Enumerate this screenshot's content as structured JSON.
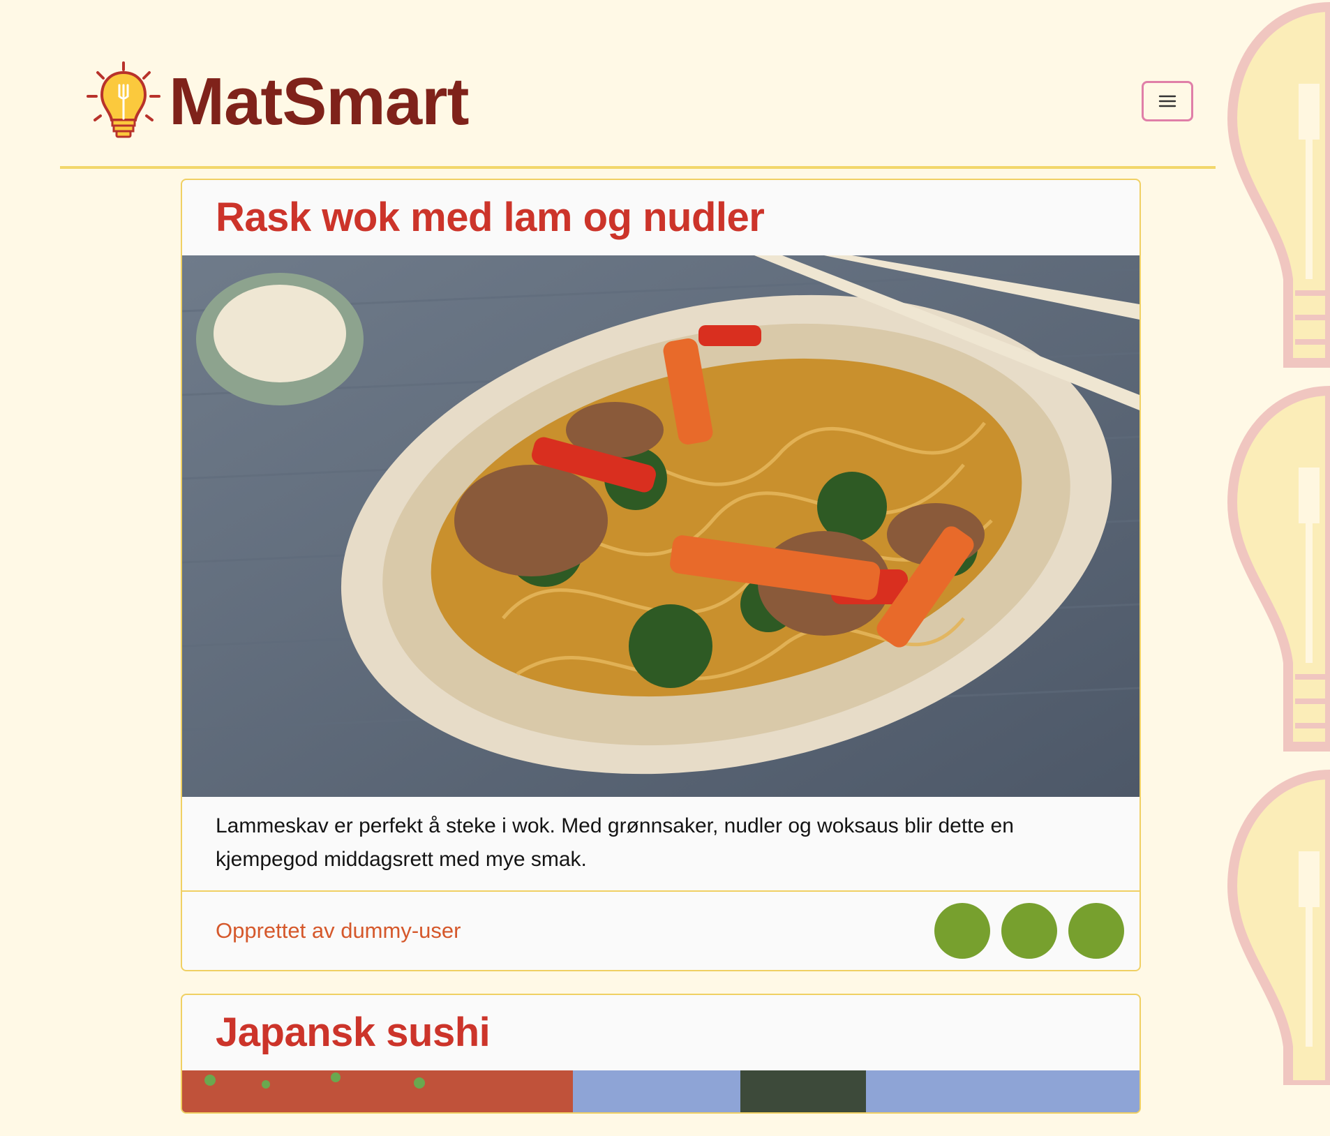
{
  "header": {
    "brand_name": "MatSmart",
    "logo_icon": "lightbulb-fork-icon",
    "menu_icon": "hamburger-menu-icon"
  },
  "recipes": [
    {
      "title": "Rask wok med lam og nudler",
      "image_alt": "Wok med lam, nudler, paprika, gulrot og grønnkål",
      "description": "Lammeskav er perfekt å steke i wok. Med grønnsaker, nudler og woksaus blir dette en kjempegod middagsrett med mye smak.",
      "author": "Opprettet av dummy-user",
      "badge_count": 3
    },
    {
      "title": "Japansk sushi",
      "image_alt": "Japansk sushi"
    }
  ],
  "colors": {
    "background": "#fff9e6",
    "brand": "#7f221a",
    "title": "#cc342a",
    "author": "#d5582b",
    "border": "#f0d063",
    "badge": "#77a02e",
    "menu_border": "#e07fa8"
  }
}
